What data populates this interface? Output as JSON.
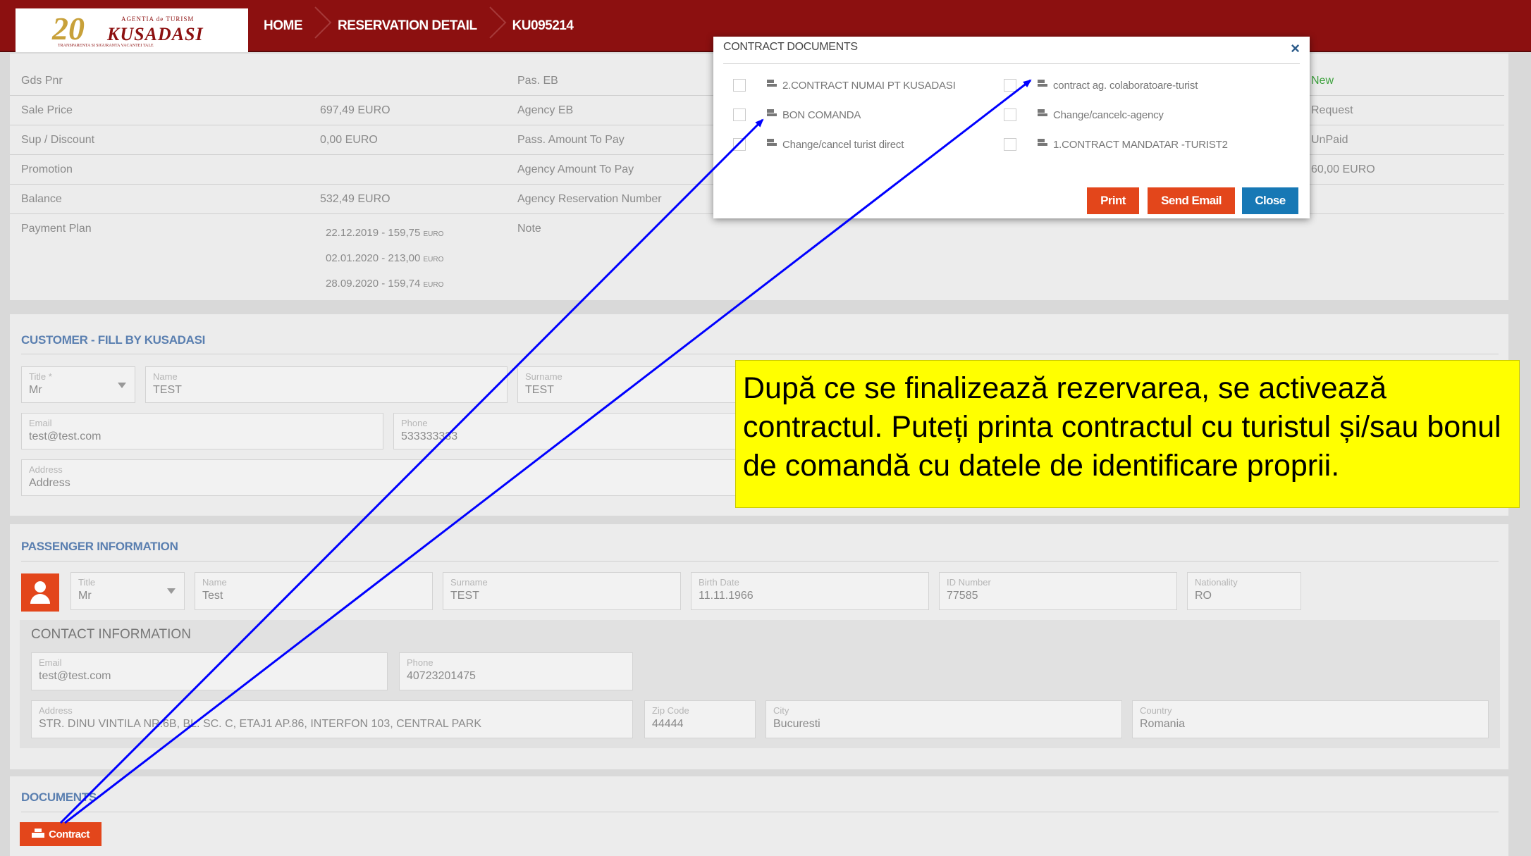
{
  "header": {
    "logo": {
      "number": "20",
      "agency": "AGENTIA de TURISM",
      "name": "KUSADASI",
      "tagline": "TRANSPARENTA SI SIGURANTA VACANTEI TALE"
    },
    "breadcrumbs": [
      "HOME",
      "RESERVATION DETAIL",
      "KU095214"
    ]
  },
  "reservation": {
    "left_labels": [
      "Gds Pnr",
      "Sale Price",
      "Sup / Discount",
      "Promotion",
      "Balance",
      "Payment Plan"
    ],
    "left_values": [
      "",
      "697,49 EURO",
      "0,00 EURO",
      "",
      "532,49 EURO",
      ""
    ],
    "mid_labels": [
      "Pas. EB",
      "Agency EB",
      "Pass. Amount To Pay",
      "Agency Amount To Pay",
      "Agency Reservation Number",
      "Note"
    ],
    "right_values": [
      "New",
      "Request",
      "UnPaid",
      "60,00 EURO"
    ],
    "payment_plan": [
      {
        "date": "22.12.2019",
        "amount": "159,75",
        "currency": "EURO"
      },
      {
        "date": "02.01.2020",
        "amount": "213,00",
        "currency": "EURO"
      },
      {
        "date": "28.09.2020",
        "amount": "159,74",
        "currency": "EURO"
      }
    ]
  },
  "customer": {
    "section_title": "CUSTOMER - FILL BY KUSADASI",
    "title_label": "Title *",
    "title_value": "Mr",
    "name_label": "Name",
    "name_value": "TEST",
    "surname_label": "Surname",
    "surname_value": "TEST",
    "email_label": "Email",
    "email_value": "test@test.com",
    "phone_label": "Phone",
    "phone_value": "533333333",
    "address_label": "Address",
    "address_value": "Address"
  },
  "passenger": {
    "section_title": "PASSENGER INFORMATION",
    "title_label": "Title",
    "title_value": "Mr",
    "name_label": "Name",
    "name_value": "Test",
    "surname_label": "Surname",
    "surname_value": "TEST",
    "birth_label": "Birth Date",
    "birth_value": "11.11.1966",
    "id_label": "ID Number",
    "id_value": "77585",
    "nationality_label": "Nationality",
    "nationality_value": "RO"
  },
  "contact": {
    "title": "CONTACT INFORMATION",
    "email_label": "Email",
    "email_value": "test@test.com",
    "phone_label": "Phone",
    "phone_value": "40723201475",
    "address_label": "Address",
    "address_value": "STR. DINU VINTILA NR.6B, BL. SC. C, ETAJ1 AP.86, INTERFON 103, CENTRAL PARK",
    "zip_label": "Zip Code",
    "zip_value": "44444",
    "city_label": "City",
    "city_value": "Bucuresti",
    "country_label": "Country",
    "country_value": "Romania"
  },
  "documents": {
    "section_title": "DOCUMENTS",
    "contract_button": "Contract"
  },
  "modal": {
    "title": "CONTRACT DOCUMENTS",
    "close_glyph": "×",
    "documents_left": [
      "2.CONTRACT NUMAI PT KUSADASI",
      "BON COMANDA",
      "Change/cancel turist direct"
    ],
    "documents_right": [
      "contract ag. colaboratoare-turist",
      "Change/cancelc-agency",
      "1.CONTRACT MANDATAR -TURIST2"
    ],
    "buttons": {
      "print": "Print",
      "send_email": "Send Email",
      "close": "Close"
    }
  },
  "callout": {
    "text": "După ce se finalizează rezervarea, se activează contractul. Puteți printa contractul cu turistul și/sau bonul de comandă cu datele de identificare proprii."
  },
  "colors": {
    "topbar": "#8c1010",
    "accent_button": "#e3461b",
    "close_button": "#1778b5",
    "section_title": "#5a7fb0",
    "callout_bg": "#ffff00",
    "arrow": "#0000ff",
    "status_new": "#3da13d"
  }
}
